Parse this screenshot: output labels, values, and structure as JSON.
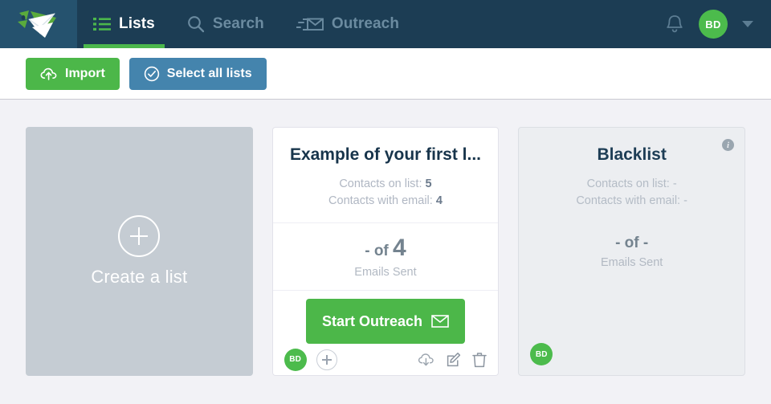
{
  "nav": {
    "logo_icon": "flying-envelope-logo",
    "items": [
      {
        "label": "Lists",
        "icon": "list-icon",
        "active": true
      },
      {
        "label": "Search",
        "icon": "search-icon",
        "active": false
      },
      {
        "label": "Outreach",
        "icon": "outreach-envelope-icon",
        "active": false
      }
    ],
    "bell_icon": "bell-icon",
    "avatar_initials": "BD",
    "caret_icon": "chevron-down-icon",
    "bg_color": "#1c3d54",
    "active_underline_color": "#4cb74c"
  },
  "toolbar": {
    "import_label": "Import",
    "import_icon": "cloud-upload-icon",
    "import_color": "#4cb749",
    "select_all_label": "Select all lists",
    "select_all_icon": "check-circle-icon",
    "select_all_color": "#4484ad"
  },
  "board": {
    "create_card": {
      "label": "Create a list",
      "icon": "plus-circle-icon"
    },
    "cards": [
      {
        "title": "Example of your first l...",
        "contacts_on_list_label": "Contacts on list:",
        "contacts_on_list_value": "5",
        "contacts_with_email_label": "Contacts with email:",
        "contacts_with_email_value": "4",
        "stat_prefix": "- of",
        "stat_value": "4",
        "stat_sub": "Emails Sent",
        "cta_label": "Start Outreach",
        "cta_icon": "envelope-icon",
        "avatar_initials": "BD",
        "add_icon": "plus-icon",
        "actions": [
          "cloud-download-icon",
          "edit-icon",
          "trash-icon"
        ],
        "has_info_icon": false,
        "muted": false
      },
      {
        "title": "Blacklist",
        "contacts_on_list_label": "Contacts on list:",
        "contacts_on_list_value": "-",
        "contacts_with_email_label": "Contacts with email:",
        "contacts_with_email_value": "-",
        "stat_prefix": "- of",
        "stat_value": "-",
        "stat_sub": "Emails Sent",
        "cta_label": "",
        "avatar_initials": "BD",
        "info_icon": "info-icon",
        "info_glyph": "i",
        "has_info_icon": true,
        "muted": true
      }
    ]
  }
}
